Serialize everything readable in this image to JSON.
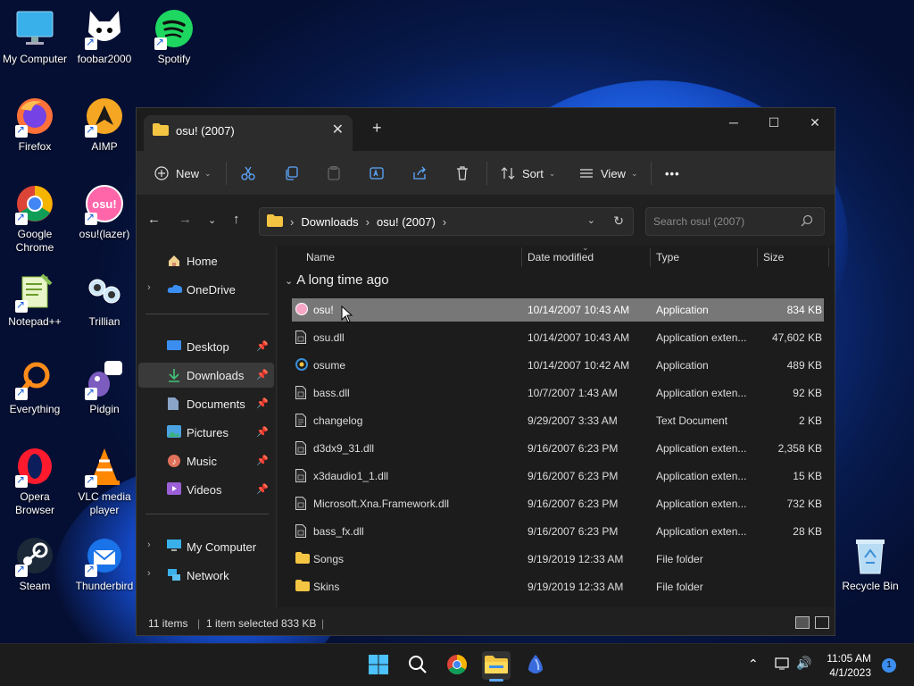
{
  "desktop": {
    "icons": [
      {
        "label": "My Computer"
      },
      {
        "label": "foobar2000"
      },
      {
        "label": "Spotify"
      },
      {
        "label": "Firefox"
      },
      {
        "label": "AIMP"
      },
      {
        "label": "Google Chrome"
      },
      {
        "label": "osu!(lazer)"
      },
      {
        "label": "Notepad++"
      },
      {
        "label": "Trillian"
      },
      {
        "label": "Everything"
      },
      {
        "label": "Pidgin"
      },
      {
        "label": "Opera Browser"
      },
      {
        "label": "VLC media player"
      },
      {
        "label": "Steam"
      },
      {
        "label": "Thunderbird"
      },
      {
        "label": "Recycle Bin"
      }
    ],
    "osu_icon_text": "osu!"
  },
  "window": {
    "tab_title": "osu! (2007)",
    "toolbar": {
      "new_label": "New",
      "sort_label": "Sort",
      "view_label": "View",
      "more_label": "•••"
    },
    "address": {
      "crumbs": [
        "Downloads",
        "osu! (2007)"
      ],
      "search_placeholder": "Search osu! (2007)"
    },
    "nav": {
      "home": "Home",
      "onedrive": "OneDrive",
      "desktop": "Desktop",
      "downloads": "Downloads",
      "documents": "Documents",
      "pictures": "Pictures",
      "music": "Music",
      "videos": "Videos",
      "my_computer": "My Computer",
      "network": "Network"
    },
    "columns": {
      "name": "Name",
      "date": "Date modified",
      "type": "Type",
      "size": "Size"
    },
    "group_label": "A long time ago",
    "files": [
      {
        "name": "osu!",
        "date": "10/14/2007 10:43 AM",
        "type": "Application",
        "size": "834 KB",
        "icon": "osu-app-icon"
      },
      {
        "name": "osu.dll",
        "date": "10/14/2007 10:43 AM",
        "type": "Application exten...",
        "size": "47,602 KB",
        "icon": "dll-file-icon"
      },
      {
        "name": "osume",
        "date": "10/14/2007 10:42 AM",
        "type": "Application",
        "size": "489 KB",
        "icon": "osume-app-icon"
      },
      {
        "name": "bass.dll",
        "date": "10/7/2007 1:43 AM",
        "type": "Application exten...",
        "size": "92 KB",
        "icon": "dll-file-icon"
      },
      {
        "name": "changelog",
        "date": "9/29/2007 3:33 AM",
        "type": "Text Document",
        "size": "2 KB",
        "icon": "text-file-icon"
      },
      {
        "name": "d3dx9_31.dll",
        "date": "9/16/2007 6:23 PM",
        "type": "Application exten...",
        "size": "2,358 KB",
        "icon": "dll-file-icon"
      },
      {
        "name": "x3daudio1_1.dll",
        "date": "9/16/2007 6:23 PM",
        "type": "Application exten...",
        "size": "15 KB",
        "icon": "dll-file-icon"
      },
      {
        "name": "Microsoft.Xna.Framework.dll",
        "date": "9/16/2007 6:23 PM",
        "type": "Application exten...",
        "size": "732 KB",
        "icon": "dll-file-icon"
      },
      {
        "name": "bass_fx.dll",
        "date": "9/16/2007 6:23 PM",
        "type": "Application exten...",
        "size": "28 KB",
        "icon": "dll-file-icon"
      },
      {
        "name": "Songs",
        "date": "9/19/2019 12:33 AM",
        "type": "File folder",
        "size": "",
        "icon": "folder-icon"
      },
      {
        "name": "Skins",
        "date": "9/19/2019 12:33 AM",
        "type": "File folder",
        "size": "",
        "icon": "folder-icon"
      }
    ],
    "status": {
      "items": "11 items",
      "selected": "1 item selected",
      "selected_size": "833 KB"
    }
  },
  "taskbar": {
    "time": "11:05 AM",
    "date": "4/1/2023",
    "notification_count": "1"
  },
  "colors": {
    "accent": "#5da8ff",
    "selection": "#777777",
    "folder": "#f4c542"
  }
}
